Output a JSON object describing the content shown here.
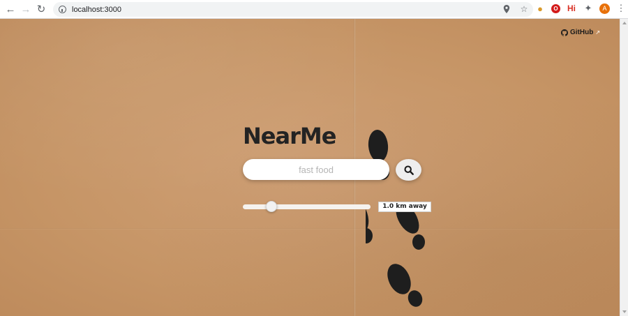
{
  "browser": {
    "url": "localhost:3000",
    "profile_initial": "A",
    "ext_hi_label": "Hi",
    "icons": [
      "back-arrow-icon",
      "forward-arrow-icon",
      "reload-icon",
      "site-info-icon",
      "location-icon",
      "bookmark-star-icon",
      "cookie-extension-icon",
      "opera-extension-icon",
      "hi-extension-icon",
      "extensions-puzzle-icon",
      "profile-avatar",
      "menu-dots-icon"
    ]
  },
  "page": {
    "github_label": "GitHub",
    "title": "NearMe",
    "search": {
      "placeholder": "fast food",
      "value": ""
    },
    "distance": {
      "label": "1.0 km away",
      "slider_fraction": 0.22
    },
    "colors": {
      "background": "#c69566",
      "text": "#232323",
      "footprint": "#1e1e1e"
    }
  }
}
